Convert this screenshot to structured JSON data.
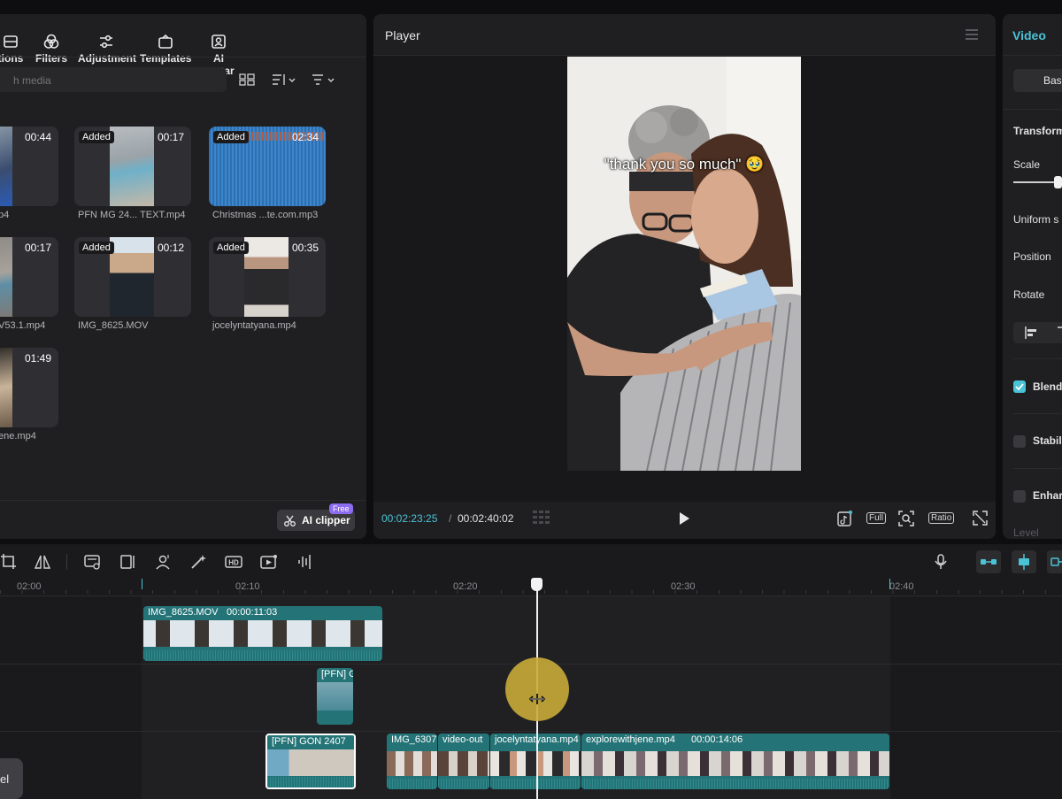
{
  "media_toolbar": {
    "items": [
      "tions",
      "Filters",
      "Adjustment",
      "Templates",
      "AI avatar"
    ]
  },
  "search": {
    "placeholder": "h media"
  },
  "media_items": [
    {
      "name": "p4",
      "duration": "00:44",
      "added": false
    },
    {
      "name": "PFN MG 24... TEXT.mp4",
      "duration": "00:17",
      "added": true
    },
    {
      "name": "Christmas ...te.com.mp3",
      "duration": "02:34",
      "added": true
    },
    {
      "name": "V53.1.mp4",
      "duration": "00:17",
      "added": false
    },
    {
      "name": "IMG_8625.MOV",
      "duration": "00:12",
      "added": true
    },
    {
      "name": "jocelyntatyana.mp4",
      "duration": "00:35",
      "added": true
    },
    {
      "name": "ene.mp4",
      "duration": "01:49",
      "added": false
    }
  ],
  "added_label": "Added",
  "ai_clipper": {
    "label": "AI clipper",
    "badge": "Free"
  },
  "player": {
    "title": "Player",
    "caption": "\"thank you so much\" 🥹",
    "current_time": "00:02:23:25",
    "separator": "/",
    "total_time": "00:02:40:02",
    "full_label": "Full",
    "ratio_label": "Ratio"
  },
  "right_panel": {
    "tab": "Video",
    "basic_btn": "Basi",
    "labels": {
      "transform": "Transform",
      "scale": "Scale",
      "uniform": "Uniform s",
      "position": "Position",
      "rotate": "Rotate",
      "blend": "Blend",
      "stabilize": "Stabil",
      "enhance": "Enhar",
      "level": "Level"
    },
    "blend_checked": true
  },
  "timeline": {
    "ruler": [
      "02:00",
      "02:10",
      "02:20",
      "02:30",
      "02:40"
    ],
    "clips": {
      "top": {
        "name": "IMG_8625.MOV",
        "time": "00:00:11:03"
      },
      "mid": {
        "name": "[PFN] G"
      },
      "main": [
        {
          "name": "[PFN] GON 2407"
        },
        {
          "name": "IMG_6307"
        },
        {
          "name": "video-out"
        },
        {
          "name": "jocelyntatyana.mp4"
        },
        {
          "name": "explorewithjene.mp4",
          "time": "00:00:14:06"
        }
      ]
    },
    "bottom_button": "el"
  },
  "colors": {
    "accent": "#4ac3d6",
    "clip": "#247477",
    "cursor_highlight": "#c9ab3a"
  }
}
